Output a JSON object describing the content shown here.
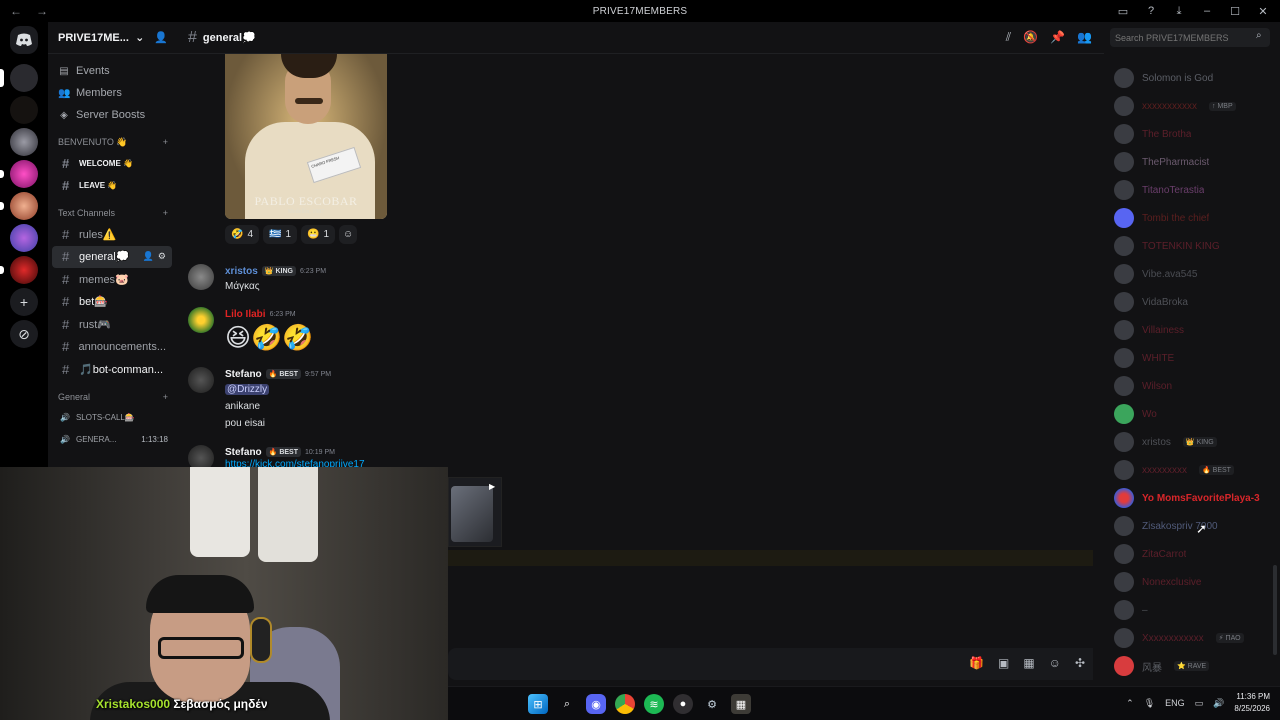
{
  "window": {
    "title": "PRIVE17MEMBERS",
    "back": "←",
    "forward": "→"
  },
  "server": {
    "name": "PRIVE17ME...",
    "chevron": "⌄"
  },
  "nav": [
    {
      "icon": "calendar-icon",
      "glyph": "▤",
      "label": "Events"
    },
    {
      "icon": "members-icon",
      "glyph": "👥",
      "label": "Members"
    },
    {
      "icon": "boost-icon",
      "glyph": "◈",
      "label": "Server Boosts"
    }
  ],
  "categories": {
    "benvenuto": "BENVENUTO 👋",
    "text": "Text Channels",
    "general": "General"
  },
  "benvenuto_channels": [
    {
      "label": "WELCOME 👋"
    },
    {
      "label": "LEAVE 👋"
    }
  ],
  "text_channels": [
    {
      "label": "rules⚠️"
    },
    {
      "label": "general💭"
    },
    {
      "label": "memes🐷"
    },
    {
      "label": "bet🎰"
    },
    {
      "label": "rust🎮"
    },
    {
      "label": "announcements..."
    },
    {
      "label": "🎵bot-comman..."
    }
  ],
  "voice_channels": [
    {
      "label": "SLOTS-CALL🎰",
      "time": ""
    },
    {
      "label": "GENERA...",
      "time": "1:13:18"
    }
  ],
  "channel": {
    "name": "general💭"
  },
  "search": {
    "placeholder": "Search PRIVE17MEMBERS"
  },
  "meme": {
    "caption": "PABLO ESCOBAR",
    "subcaption": "Medellín, 1987",
    "tag_text": "CHARO FRESH"
  },
  "reactions": [
    {
      "emoji": "🤣",
      "count": "4"
    },
    {
      "emoji": "🇬🇷",
      "count": "1"
    },
    {
      "emoji": "😬",
      "count": "1"
    }
  ],
  "messages": [
    {
      "user": "xristos",
      "badge": "👑 KING",
      "time": "6:23 PM",
      "lines": [
        "Μάγκας"
      ],
      "user_color": "#5e8fd6"
    },
    {
      "user": "Lilo Ilabi",
      "badge": "",
      "time": "6:23 PM",
      "emoji": "😆🤣🤣",
      "user_color": "#e02424"
    },
    {
      "user": "Stefano",
      "badge": "🔥 BEST",
      "time": "9:57 PM",
      "mention": "@Drizzly",
      "lines": [
        "anikane",
        "pou eisai"
      ],
      "user_color": "#f2f3f5"
    },
    {
      "user": "Stefano",
      "badge": "🔥 BEST",
      "time": "10:19 PM",
      "link": "https://kick.com/stefanoprijve17",
      "user_color": "#f2f3f5"
    }
  ],
  "members": [
    {
      "name": "Solomon is God",
      "color": "#5b5e66",
      "badge": ""
    },
    {
      "name": "xxxxxxxxxxx",
      "color": "#5c1f1f",
      "badge": "↑ MBP"
    },
    {
      "name": "The Brotha",
      "color": "#5c1f2a",
      "badge": ""
    },
    {
      "name": "ThePharmacist",
      "color": "#6b5a6e",
      "badge": ""
    },
    {
      "name": "TitanoTerastia",
      "color": "#6a3e6b",
      "badge": ""
    },
    {
      "name": "Tombi the chief",
      "color": "#5c1f1f",
      "badge": ""
    },
    {
      "name": "TOTENKIN KING",
      "color": "#5c1f2a",
      "badge": ""
    },
    {
      "name": "Vibe.ava545",
      "color": "#4a4c52",
      "badge": ""
    },
    {
      "name": "VidaBroka",
      "color": "#4e5056",
      "badge": ""
    },
    {
      "name": "Villainess",
      "color": "#5c1f2a",
      "badge": ""
    },
    {
      "name": "WHITE",
      "color": "#5c1f2a",
      "badge": ""
    },
    {
      "name": "Wilson",
      "color": "#5c1f2a",
      "badge": ""
    },
    {
      "name": "Wo",
      "color": "#5c1f2a",
      "badge": ""
    },
    {
      "name": "xristos",
      "color": "#4e5056",
      "badge": "👑 KING"
    },
    {
      "name": "xxxxxxxxx",
      "color": "#5c1f2a",
      "badge": "🔥 BEST"
    },
    {
      "name": "Yo MomsFavoritePlaya-3",
      "color": "#d8262a",
      "badge": ""
    },
    {
      "name": "Zisakospriv 7000",
      "color": "#515b7a",
      "badge": ""
    },
    {
      "name": "ZitaCarrot",
      "color": "#5c1f2a",
      "badge": ""
    },
    {
      "name": "Nonexclusive",
      "color": "#5c1f2a",
      "badge": ""
    },
    {
      "name": "–",
      "color": "#4e5056",
      "badge": ""
    },
    {
      "name": "Xxxxxxxxxxxx",
      "color": "#5c1f2a",
      "badge": "⚡ ПАО"
    },
    {
      "name": "风暴",
      "color": "#5a5d63",
      "badge": "⭐ RAVE"
    }
  ],
  "webcam": {
    "caption_user": "Xristakos000",
    "caption_text": "Σεβασμός μηδέν"
  },
  "taskbar": {
    "lang": "ENG",
    "time": "11:36 PM",
    "date": "8/25/2026"
  },
  "colors": {
    "accent": "#5865f2",
    "bg": "#121214",
    "rail": "#000000",
    "mention": "#3c4270"
  }
}
